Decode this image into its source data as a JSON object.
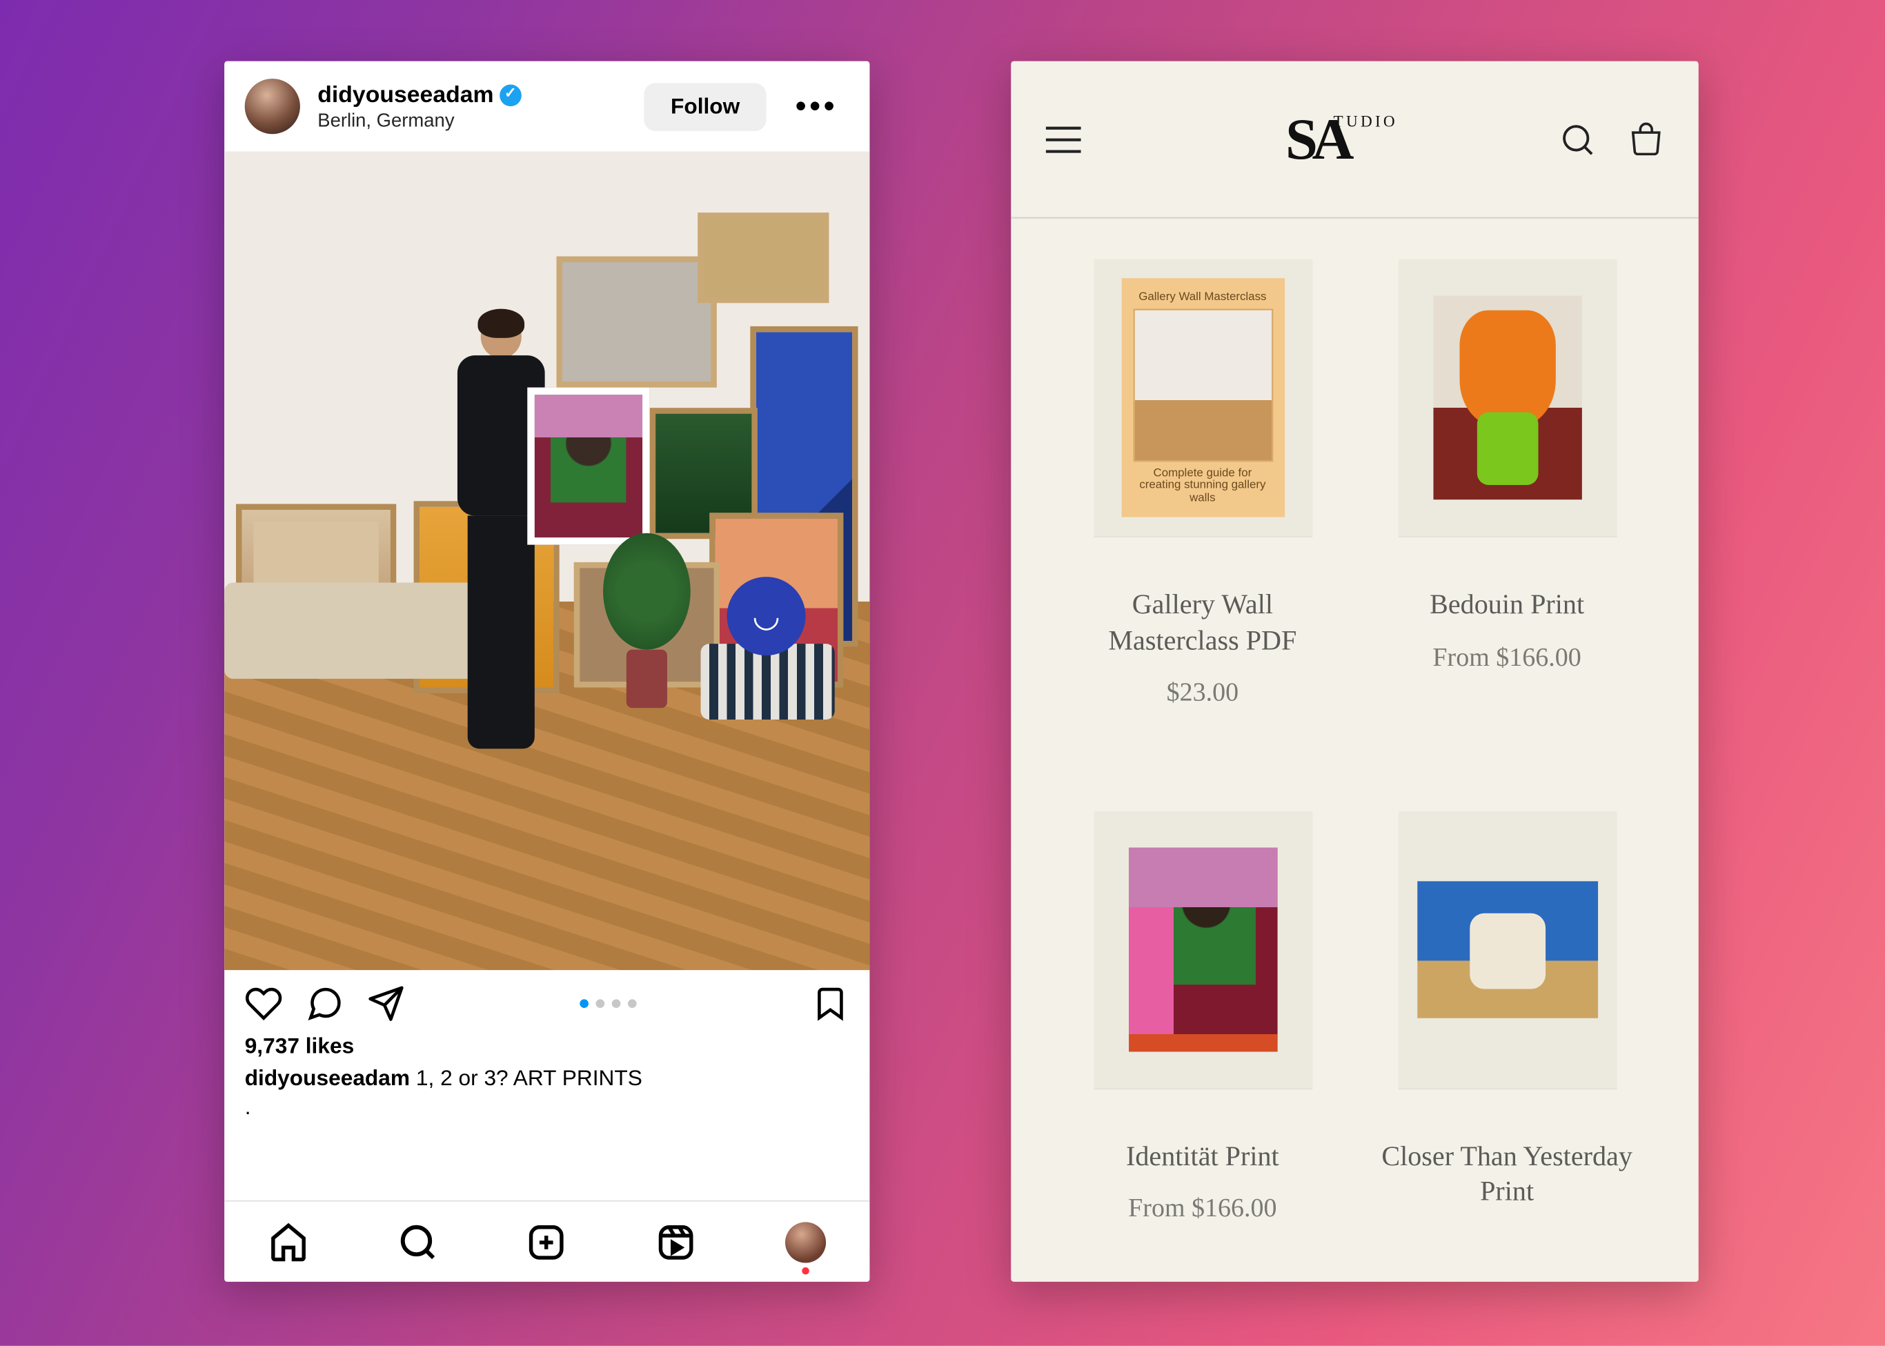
{
  "instagram": {
    "username": "didyouseeadam",
    "location": "Berlin, Germany",
    "follow_label": "Follow",
    "likes_text": "9,737 likes",
    "caption_username": "didyouseeadam",
    "caption_text": "1, 2 or 3? ART PRINTS",
    "carousel_total": 4,
    "carousel_active": 0
  },
  "store": {
    "logo_text": "SA",
    "logo_sub": "TUDIO",
    "products": [
      {
        "title": "Gallery Wall Masterclass PDF",
        "price": "$23.00",
        "cover_top": "Gallery Wall Masterclass",
        "cover_bottom": "Complete guide for creating stunning gallery walls"
      },
      {
        "title": "Bedouin Print",
        "price": "From $166.00"
      },
      {
        "title": "Identität Print",
        "price": "From $166.00"
      },
      {
        "title": "Closer Than Yesterday Print",
        "price": ""
      }
    ]
  }
}
